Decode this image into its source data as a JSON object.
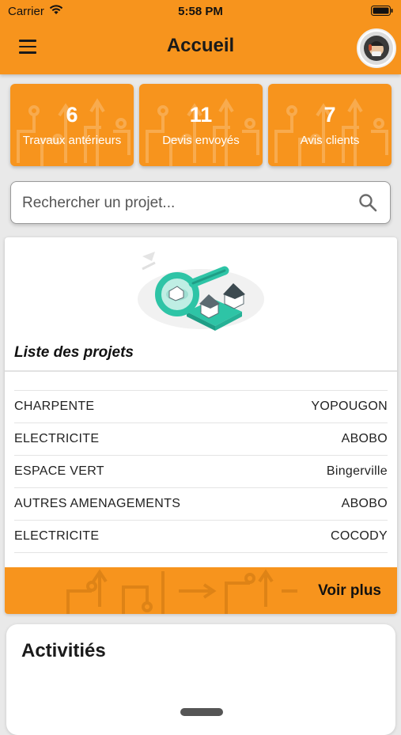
{
  "status_bar": {
    "carrier": "Carrier",
    "time": "5:58 PM"
  },
  "nav": {
    "title": "Accueil"
  },
  "stats": [
    {
      "value": "6",
      "label": "Travaux antérieurs"
    },
    {
      "value": "11",
      "label": "Devis envoyés"
    },
    {
      "value": "7",
      "label": "Avis clients"
    }
  ],
  "search": {
    "placeholder": "Rechercher un projet..."
  },
  "projects": {
    "title": "Liste des projets",
    "rows": [
      {
        "category": "CHARPENTE",
        "location": "YOPOUGON"
      },
      {
        "category": "ELECTRICITE",
        "location": "ABOBO"
      },
      {
        "category": "ESPACE VERT",
        "location": "Bingerville"
      },
      {
        "category": "AUTRES AMENAGEMENTS",
        "location": "ABOBO"
      },
      {
        "category": "ELECTRICITE",
        "location": "COCODY"
      }
    ],
    "see_more": "Voir plus"
  },
  "activities": {
    "title": "Activitiés"
  },
  "colors": {
    "accent": "#f7941d",
    "background": "#e9e9e9",
    "illustration": "#2ec4a6"
  },
  "icons": [
    "wifi-icon",
    "battery-icon",
    "menu-icon",
    "avatar",
    "search-icon",
    "magnifier-house-illustration"
  ]
}
